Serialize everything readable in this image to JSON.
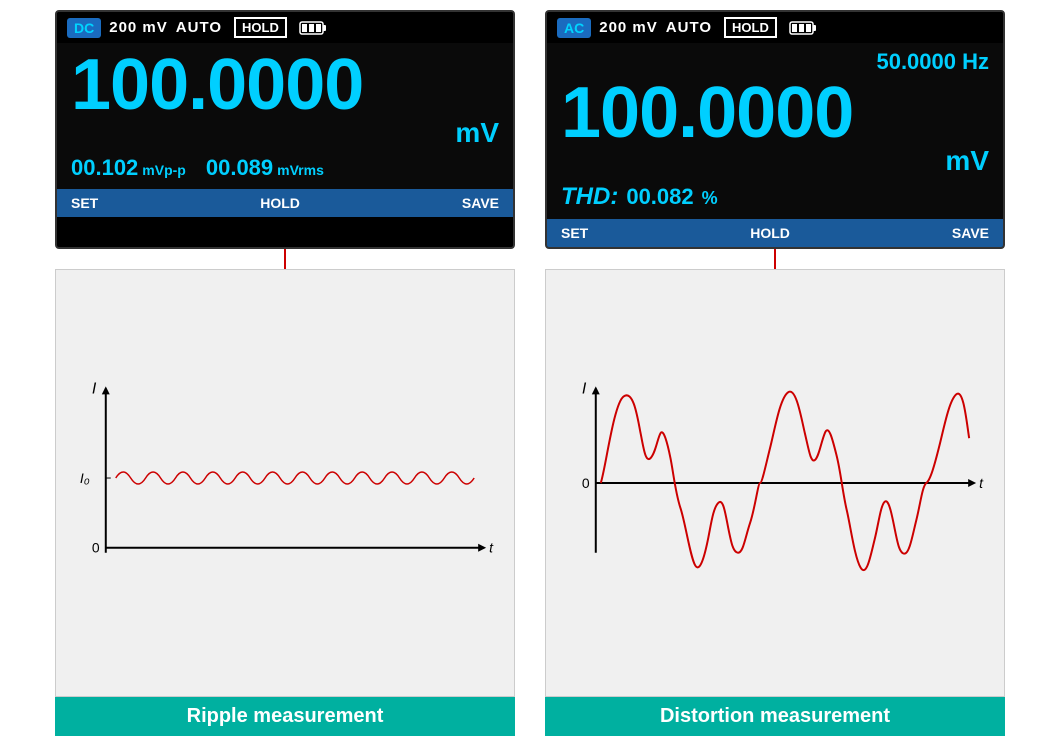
{
  "left_meter": {
    "mode": "DC",
    "range": "200 mV",
    "auto": "AUTO",
    "hold_badge": "HOLD",
    "main_value": "100.0000",
    "main_unit": "mV",
    "freq": null,
    "sub1_value": "00.102",
    "sub1_unit": "mVp-p",
    "sub2_value": "00.089",
    "sub2_unit": "mVrms",
    "thd": null,
    "footer": {
      "set": "SET",
      "hold": "HOLD",
      "save": "SAVE"
    }
  },
  "right_meter": {
    "mode": "AC",
    "range": "200 mV",
    "auto": "AUTO",
    "hold_badge": "HOLD",
    "main_value": "100.0000",
    "main_unit": "mV",
    "freq": "50.0000 Hz",
    "thd_label": "THD:",
    "thd_value": "00.082",
    "thd_unit": "%",
    "footer": {
      "set": "SET",
      "hold": "HOLD",
      "save": "SAVE"
    }
  },
  "left_chart": {
    "label": "Ripple measurement",
    "axis_i": "I",
    "axis_i0": "I₀",
    "axis_0": "0",
    "axis_t": "t"
  },
  "right_chart": {
    "label": "Distortion measurement",
    "axis_i": "I",
    "axis_0": "0",
    "axis_t": "t"
  }
}
